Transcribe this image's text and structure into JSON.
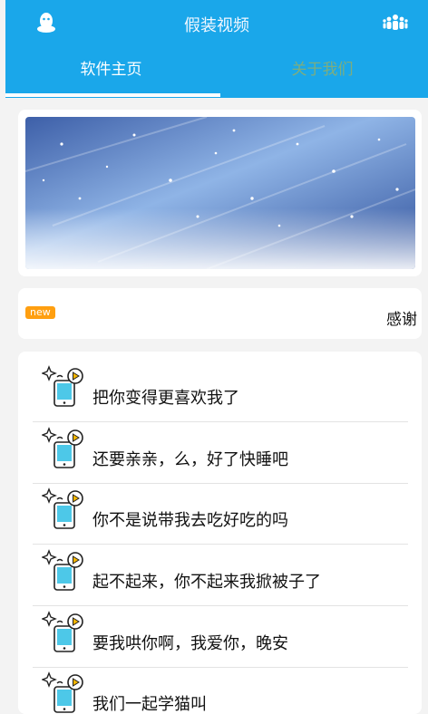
{
  "header": {
    "title": "假装视频",
    "left_icon": "qq-penguin-icon",
    "right_icon": "group-people-icon"
  },
  "tabs": [
    {
      "label": "软件主页",
      "active": true
    },
    {
      "label": "关于我们",
      "active": false
    }
  ],
  "notice": {
    "badge": "new",
    "text": "感谢"
  },
  "videos": [
    "把你变得更喜欢我了",
    "还要亲亲，么，好了快睡吧",
    "你不是说带我去吃好吃的吗",
    "起不起来，你不起来我掀被子了",
    "要我哄你啊，我爱你，晚安",
    "我们一起学猫叫"
  ],
  "colors": {
    "accent": "#1aa7ea",
    "badge": "#ff9f10"
  }
}
